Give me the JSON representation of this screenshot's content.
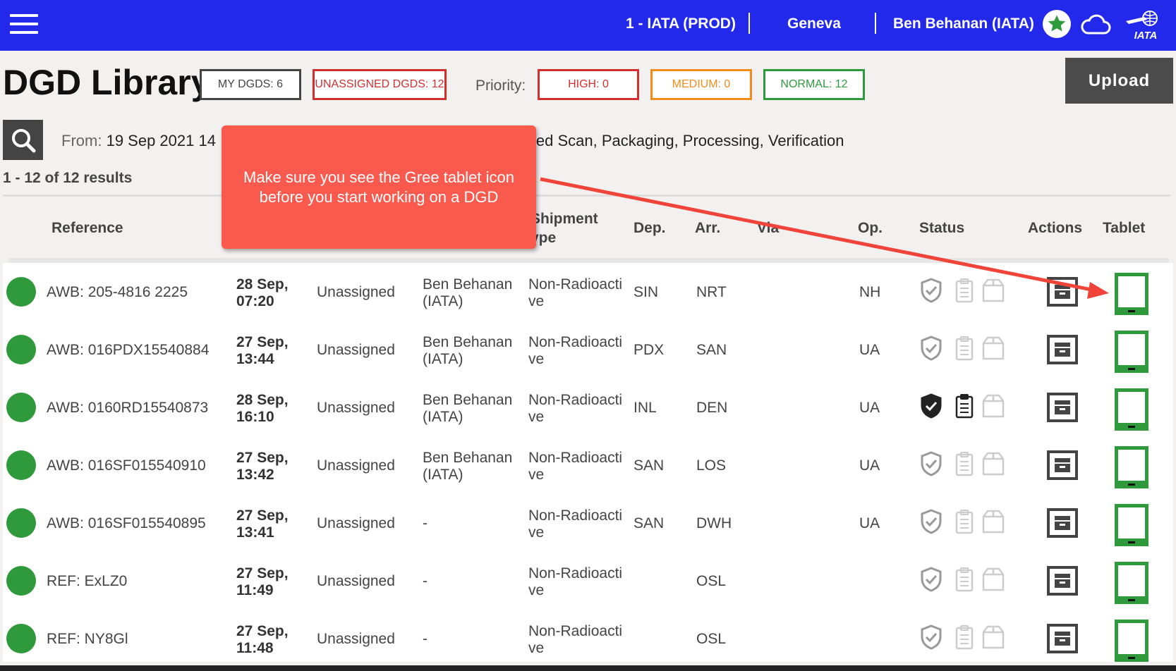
{
  "topbar": {
    "env": "1 - IATA (PROD)",
    "location": "Geneva",
    "user": "Ben Behanan (IATA)",
    "icons": [
      "menu-icon",
      "star-icon",
      "cloud-icon",
      "iata-logo"
    ],
    "logo_text": "IATA",
    "color": "#2329ea"
  },
  "header": {
    "title": "DGD Library",
    "my_dgds": "MY DGDS: 6",
    "unassigned_dgds": "UNASSIGNED DGDS: 12",
    "priority_label": "Priority:",
    "high": "HIGH: 0",
    "medium": "MEDIUM: 0",
    "normal": "NORMAL: 12",
    "upload": "Upload"
  },
  "filters": {
    "from_label": "From:",
    "from_value": "19 Sep 2021 14",
    "stages": "led Scan, Packaging, Processing, Verification"
  },
  "results": "1 - 12 of 12 results",
  "table": {
    "headers": {
      "reference": "Reference",
      "shipment_type_1": "Shipment",
      "shipment_type_2": "ype",
      "dep": "Dep.",
      "arr": "Arr.",
      "via": "Via",
      "op": "Op.",
      "status": "Status",
      "actions": "Actions",
      "tablet": "Tablet"
    },
    "rows": [
      {
        "ref": "AWB: 205-4816 2225",
        "date1": "28 Sep,",
        "date2": "07:20",
        "assignee": "Unassigned",
        "owner1": "Ben Behanan",
        "owner2": "(IATA)",
        "type1": "Non-Radioacti",
        "type2": "ve",
        "dep": "SIN",
        "arr": "NRT",
        "op": "NH"
      },
      {
        "ref": "AWB: 016PDX15540884",
        "date1": "27 Sep,",
        "date2": "13:44",
        "assignee": "Unassigned",
        "owner1": "Ben Behanan",
        "owner2": "(IATA)",
        "type1": "Non-Radioacti",
        "type2": "ve",
        "dep": "PDX",
        "arr": "SAN",
        "op": "UA"
      },
      {
        "ref": "AWB: 0160RD15540873",
        "date1": "28 Sep,",
        "date2": "16:10",
        "assignee": "Unassigned",
        "owner1": "Ben Behanan",
        "owner2": "(IATA)",
        "type1": "Non-Radioacti",
        "type2": "ve",
        "dep": "INL",
        "arr": "DEN",
        "op": "UA"
      },
      {
        "ref": "AWB: 016SF015540910",
        "date1": "27 Sep,",
        "date2": "13:42",
        "assignee": "Unassigned",
        "owner1": "Ben Behanan",
        "owner2": "(IATA)",
        "type1": "Non-Radioacti",
        "type2": "ve",
        "dep": "SAN",
        "arr": "LOS",
        "op": "UA"
      },
      {
        "ref": "AWB: 016SF015540895",
        "date1": "27 Sep,",
        "date2": "13:41",
        "assignee": "Unassigned",
        "owner1": "-",
        "owner2": "",
        "type1": "Non-Radioacti",
        "type2": "ve",
        "dep": "SAN",
        "arr": "DWH",
        "op": "UA"
      },
      {
        "ref": "REF: ExLZ0",
        "date1": "27 Sep,",
        "date2": "11:49",
        "assignee": "Unassigned",
        "owner1": "-",
        "owner2": "",
        "type1": "Non-Radioacti",
        "type2": "ve",
        "dep": "",
        "arr": "OSL",
        "op": ""
      },
      {
        "ref": "REF: NY8Gl",
        "date1": "27 Sep,",
        "date2": "11:48",
        "assignee": "Unassigned",
        "owner1": "-",
        "owner2": "",
        "type1": "Non-Radioacti",
        "type2": "ve",
        "dep": "",
        "arr": "OSL",
        "op": ""
      }
    ]
  },
  "callout": {
    "text": "Make sure you see the Gree tablet icon before you start working on a DGD",
    "color": "#fa5a4e"
  },
  "colors": {
    "green": "#2f9a3c",
    "red": "#d32f2f",
    "orange": "#f28c1c",
    "grey_badge": "#444"
  }
}
